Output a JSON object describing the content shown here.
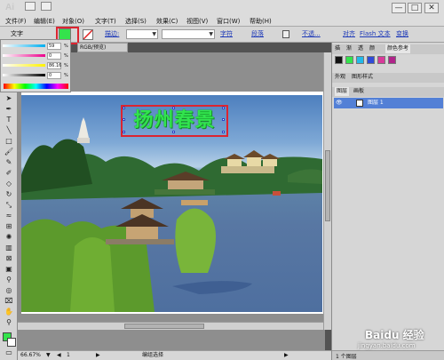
{
  "app": {
    "logo": "Ai"
  },
  "menubar": {
    "items": [
      "文件(F)",
      "编辑(E)",
      "对象(O)",
      "文字(T)",
      "选择(S)",
      "效果(C)",
      "视图(V)",
      "窗口(W)",
      "帮助(H)"
    ],
    "window_controls": [
      "—",
      "□",
      "✕"
    ]
  },
  "control_bar": {
    "label": "文字",
    "stroke_label": "描边:",
    "char_link": "字符",
    "para_link": "段落",
    "opacity_label": "不透...",
    "align_link": "对齐",
    "flash_text_link": "Flash 文本",
    "transform_link": "变换"
  },
  "color_panel": {
    "values": [
      "59",
      "0",
      "86.16",
      "0"
    ],
    "unit": "%"
  },
  "document": {
    "tab_title": "RGB/预览)",
    "title_text": "扬州春景"
  },
  "statusbar": {
    "zoom": "66.67%",
    "page": "1",
    "status": "编组选择"
  },
  "panels": {
    "top_tabs": [
      "描",
      "渐",
      "透",
      "颜",
      "颜色参考"
    ],
    "mid_tabs": [
      "外观",
      "图形样式"
    ],
    "layer_tabs": [
      "图层",
      "画板"
    ],
    "layer_name": "图层 1",
    "layer_count": "1 个图层"
  },
  "watermark": "Baidu 经验",
  "watermark_url": "jingyan.baidu.com",
  "colors": {
    "title_green": "#31e44d",
    "highlight_red": "#dc2430",
    "selection_blue": "#2f47c5",
    "fill_swatch": "#34e34c"
  }
}
